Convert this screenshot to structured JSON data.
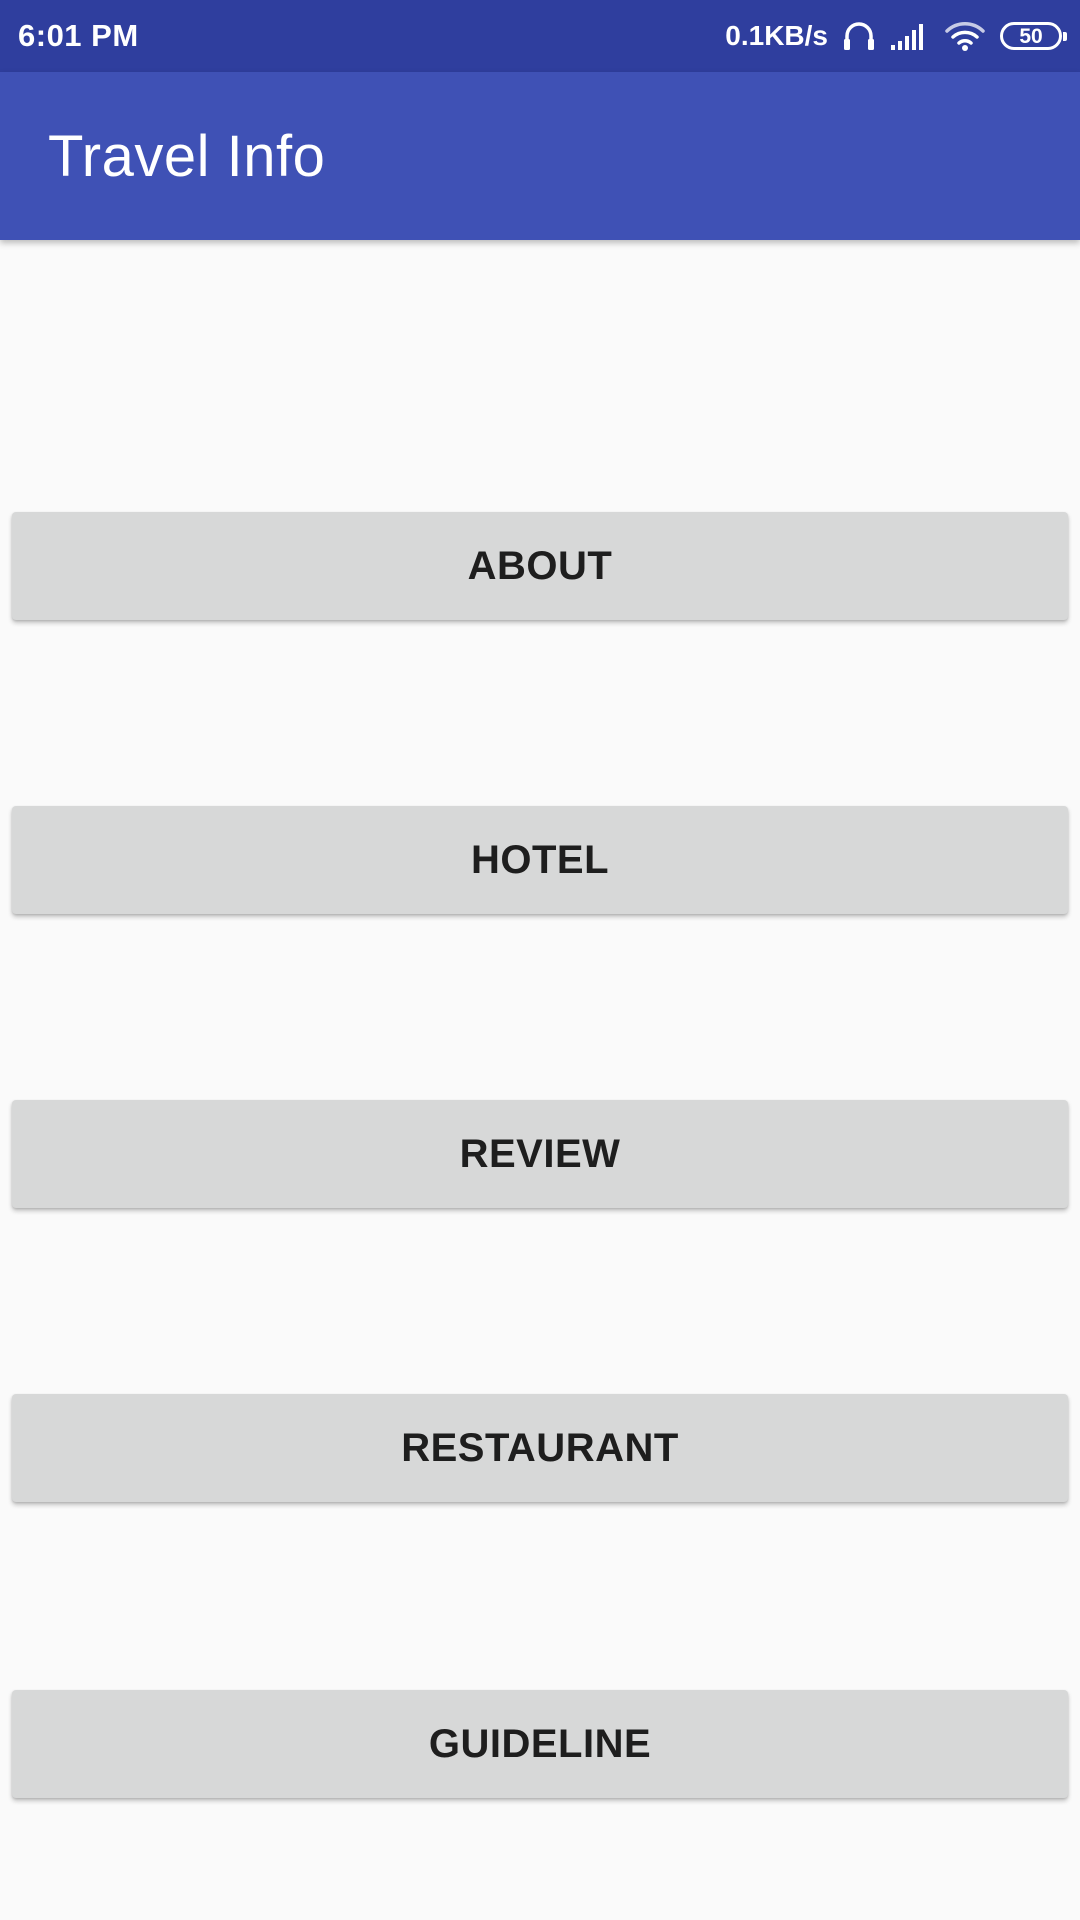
{
  "status_bar": {
    "time": "6:01 PM",
    "net_speed": "0.1KB/s",
    "battery_level": "50",
    "icons": [
      "headphones-icon",
      "signal-icon",
      "wifi-icon",
      "battery-icon"
    ]
  },
  "app_bar": {
    "title": "Travel Info",
    "color": "#3f51b5",
    "status_color": "#2f3e9e"
  },
  "buttons": [
    {
      "label": "ABOUT"
    },
    {
      "label": "HOTEL"
    },
    {
      "label": "REVIEW"
    },
    {
      "label": "RESTAURANT"
    },
    {
      "label": "GUIDELINE"
    }
  ]
}
